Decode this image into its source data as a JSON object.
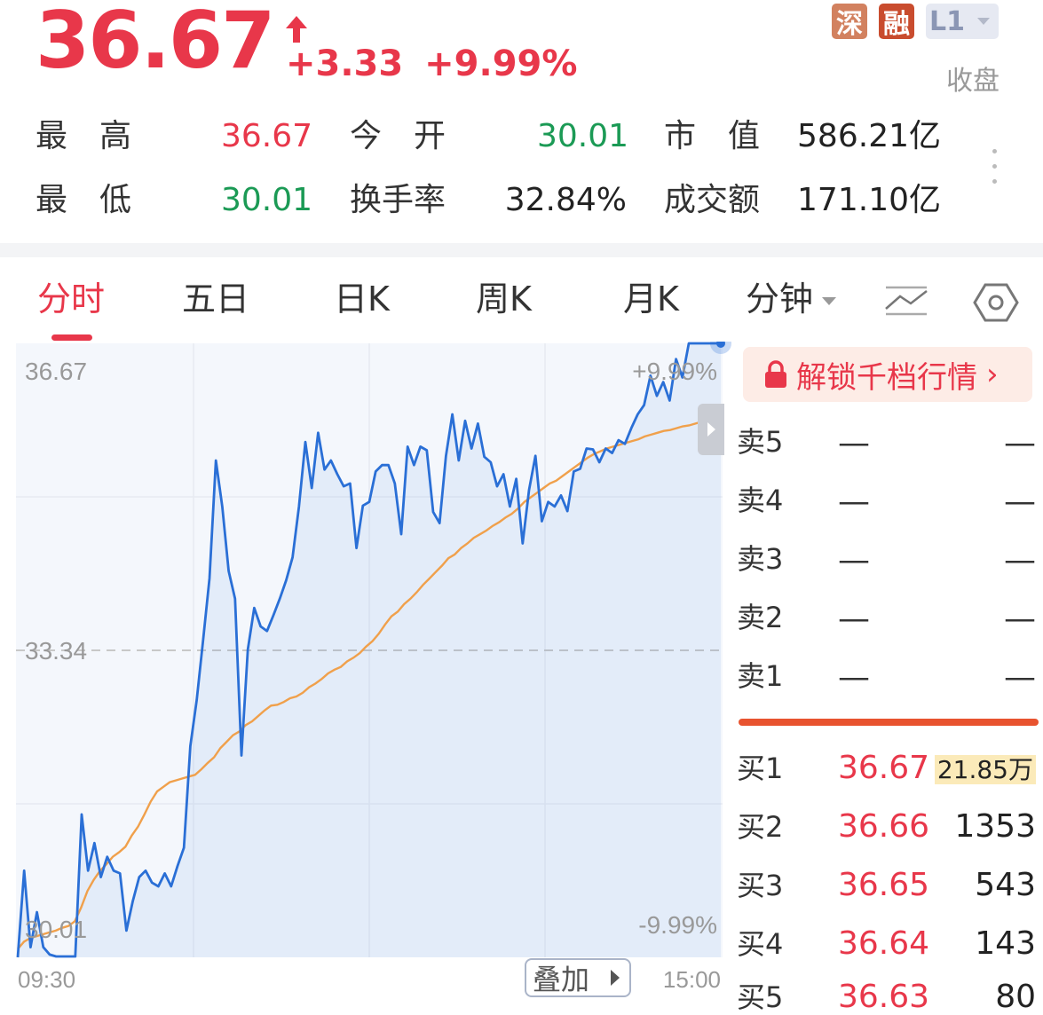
{
  "header": {
    "price": "36.67",
    "change": "+3.33",
    "change_pct": "+9.99%",
    "status": "收盘",
    "tags": {
      "shen": "深",
      "rong": "融",
      "level": "L1"
    }
  },
  "stats": {
    "high_label": "最　高",
    "high": "36.67",
    "open_label": "今　开",
    "open": "30.01",
    "mktcap_label": "市　值",
    "mktcap": "586.21亿",
    "low_label": "最　低",
    "low": "30.01",
    "turnover_label": "换手率",
    "turnover": "32.84%",
    "amount_label": "成交额",
    "amount": "171.10亿"
  },
  "tabs": [
    "分时",
    "五日",
    "日K",
    "周K",
    "月K",
    "分钟"
  ],
  "colors": {
    "up": "#e8374a",
    "down": "#1b9a55",
    "price_line": "#2a6fd6",
    "avg_line": "#f0a04b"
  },
  "chart_data": {
    "type": "line",
    "y_labels": {
      "top": "36.67",
      "mid": "33.34",
      "bottom": "30.01"
    },
    "pct_labels": {
      "top": "+9.99%",
      "bottom": "-9.99%"
    },
    "x_labels": {
      "start": "09:30",
      "end": "15:00"
    },
    "ylim": [
      30.01,
      36.67
    ],
    "overlay_label": "叠加",
    "series": [
      {
        "values": [
          30.01,
          30.95,
          30.12,
          30.5,
          30.12,
          30.04,
          30.02,
          30.02,
          30.02,
          30.02,
          31.56,
          30.95,
          31.25,
          30.88,
          31.1,
          30.95,
          30.92,
          30.3,
          30.62,
          30.88,
          30.95,
          30.82,
          30.78,
          30.92,
          30.78,
          31.0,
          31.2,
          32.3,
          32.8,
          33.45,
          34.12,
          35.4,
          34.9,
          34.2,
          33.9,
          32.2,
          33.35,
          33.8,
          33.6,
          33.55,
          33.72,
          33.9,
          34.1,
          34.35,
          34.9,
          35.6,
          35.1,
          35.7,
          35.3,
          35.4,
          35.25,
          35.12,
          35.15,
          34.45,
          34.91,
          34.95,
          35.28,
          35.35,
          35.35,
          35.15,
          34.6,
          35.55,
          35.35,
          35.55,
          35.51,
          34.84,
          34.72,
          35.45,
          35.9,
          35.4,
          35.83,
          35.53,
          35.8,
          35.44,
          35.38,
          35.12,
          35.25,
          34.9,
          35.2,
          34.5,
          35.08,
          35.45,
          34.74,
          34.95,
          34.9,
          35.02,
          34.85,
          35.28,
          35.31,
          35.53,
          35.52,
          35.38,
          35.53,
          35.48,
          35.62,
          35.58,
          35.75,
          35.9,
          36.0,
          36.32,
          36.1,
          36.25,
          36.05,
          36.5,
          36.3,
          36.67,
          36.67,
          36.67,
          36.67,
          36.67,
          36.67
        ]
      },
      {
        "values": [
          30.1,
          30.18,
          30.22,
          30.24,
          30.26,
          30.28,
          30.3,
          30.33,
          30.35,
          30.4,
          30.55,
          30.73,
          30.85,
          30.95,
          31.02,
          31.1,
          31.15,
          31.21,
          31.33,
          31.43,
          31.56,
          31.7,
          31.81,
          31.86,
          31.91,
          31.93,
          31.95,
          31.97,
          31.99,
          32.05,
          32.12,
          32.18,
          32.28,
          32.35,
          32.42,
          32.46,
          32.53,
          32.57,
          32.63,
          32.69,
          32.74,
          32.75,
          32.78,
          32.82,
          32.84,
          32.88,
          32.94,
          32.98,
          33.03,
          33.09,
          33.13,
          33.16,
          33.22,
          33.26,
          33.31,
          33.38,
          33.44,
          33.52,
          33.62,
          33.71,
          33.76,
          33.84,
          33.9,
          33.97,
          34.05,
          34.12,
          34.19,
          34.26,
          34.34,
          34.38,
          34.45,
          34.5,
          34.56,
          34.6,
          34.64,
          34.69,
          34.73,
          34.78,
          34.82,
          34.88,
          34.95,
          35.0,
          35.05,
          35.1,
          35.15,
          35.18,
          35.23,
          35.28,
          35.33,
          35.38,
          35.43,
          35.47,
          35.5,
          35.53,
          35.55,
          35.57,
          35.59,
          35.61,
          35.63,
          35.66,
          35.68,
          35.7,
          35.72,
          35.73,
          35.75,
          35.77,
          35.78,
          35.8,
          35.82,
          35.83,
          35.85,
          35.88
        ]
      }
    ]
  },
  "orderbook": {
    "unlock_label": "解锁千档行情",
    "dash": "—",
    "asks": [
      {
        "label": "卖5"
      },
      {
        "label": "卖4"
      },
      {
        "label": "卖3"
      },
      {
        "label": "卖2"
      },
      {
        "label": "卖1"
      }
    ],
    "bids": [
      {
        "label": "买1",
        "price": "36.67",
        "vol": "21.85万"
      },
      {
        "label": "买2",
        "price": "36.66",
        "vol": "1353"
      },
      {
        "label": "买3",
        "price": "36.65",
        "vol": "543"
      },
      {
        "label": "买4",
        "price": "36.64",
        "vol": "143"
      },
      {
        "label": "买5",
        "price": "36.63",
        "vol": "80"
      }
    ]
  }
}
